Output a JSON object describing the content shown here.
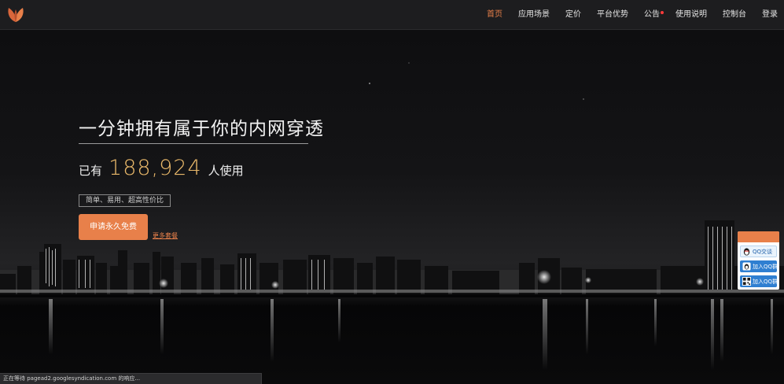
{
  "nav": {
    "items": [
      {
        "label": "首页",
        "active": true,
        "dot": false
      },
      {
        "label": "应用场景",
        "active": false,
        "dot": false
      },
      {
        "label": "定价",
        "active": false,
        "dot": false
      },
      {
        "label": "平台优势",
        "active": false,
        "dot": false
      },
      {
        "label": "公告",
        "active": false,
        "dot": true
      },
      {
        "label": "使用说明",
        "active": false,
        "dot": false
      },
      {
        "label": "控制台",
        "active": false,
        "dot": false
      },
      {
        "label": "登录",
        "active": false,
        "dot": false
      }
    ]
  },
  "hero": {
    "headline": "一分钟拥有属于你的内网穿透",
    "users_prefix": "已有",
    "users_count": "188,924",
    "users_suffix": "人使用",
    "features": "简单、易用、超高性价比",
    "cta_label": "申请永久免费",
    "more_link": "更多套餐"
  },
  "qq_widget": {
    "items": [
      {
        "label": "QQ交谈",
        "icon": "qq-penguin-icon"
      },
      {
        "label": "加入QQ群",
        "icon": "qq-group-icon"
      },
      {
        "label": "加入QQ群",
        "icon": "qr-code-icon"
      }
    ]
  },
  "status": {
    "text": "正在等待 pagead2.googlesyndication.com 的响应..."
  },
  "colors": {
    "accent": "#e8804a",
    "count": "#e9b86a",
    "nav_bg": "#1d1d1f",
    "notice_dot": "#ff3b3b"
  }
}
